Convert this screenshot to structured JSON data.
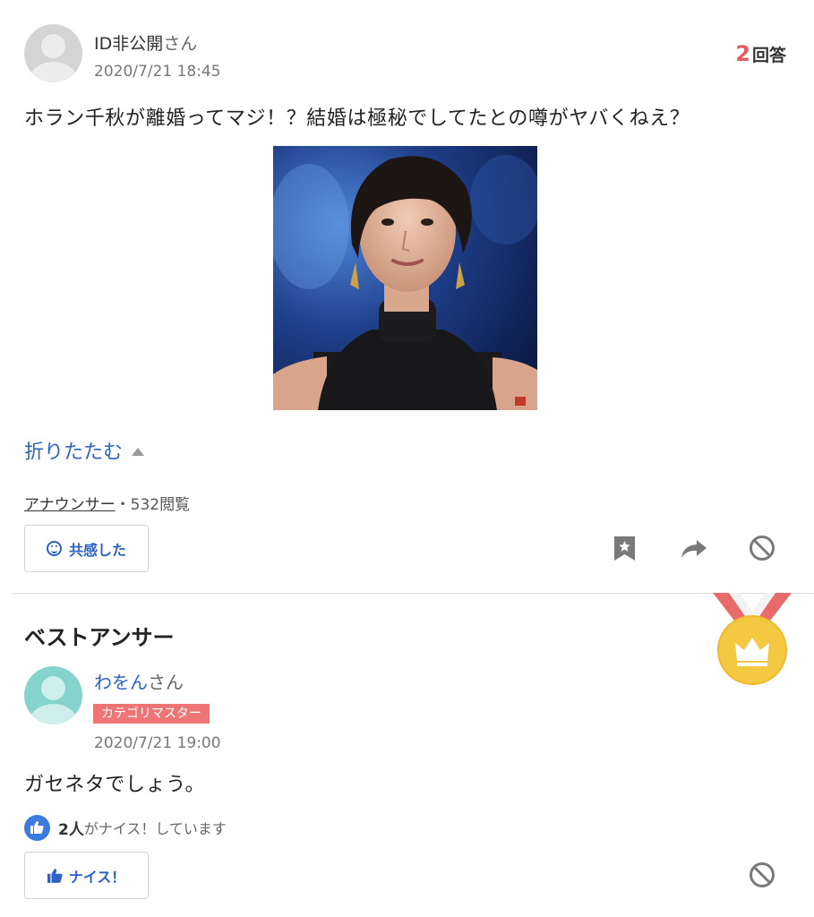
{
  "question": {
    "asker_name": "ID非公開",
    "asker_suffix": "さん",
    "date": "2020/7/21 18:45",
    "answer_count_num": "2",
    "answer_count_label": "回答",
    "text": "ホラン千秋が離婚ってマジ！？結婚は極秘でしてたとの噂がヤバくねえ？",
    "collapse_label": "折りたたむ",
    "category": "アナウンサー",
    "views": "・532閲覧",
    "sympathy_button": "共感した",
    "icons": [
      "bookmark-icon",
      "share-icon",
      "block-icon"
    ]
  },
  "best_answer": {
    "heading": "ベストアンサー",
    "answerer_name": "わをん",
    "answerer_suffix": "さん",
    "badge": "カテゴリマスター",
    "date": "2020/7/21 19:00",
    "text": "ガセネタでしょう。",
    "nice_count": "2人",
    "nice_suffix": "がナイス！しています",
    "nice_button": "ナイス！",
    "icons": [
      "medal-crown-icon",
      "thumbs-up-icon",
      "block-icon"
    ]
  },
  "colors": {
    "link_blue": "#2d63c8",
    "count_red": "#e55a5a",
    "badge_red": "#ee7575",
    "medal_gold": "#f5c842",
    "ribbon_red": "#e86a6a"
  }
}
